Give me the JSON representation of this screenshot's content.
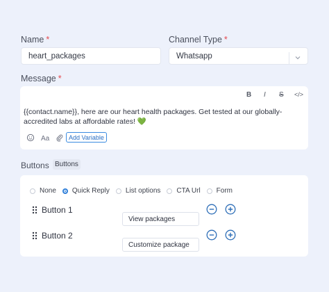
{
  "name": {
    "label": "Name",
    "required_mark": "*",
    "value": "heart_packages"
  },
  "channel": {
    "label": "Channel Type",
    "required_mark": "*",
    "value": "Whatsapp"
  },
  "message": {
    "label": "Message",
    "required_mark": "*",
    "toolbar": {
      "bold": "B",
      "italic": "I",
      "strike": "S",
      "code": "</>"
    },
    "text": "{{contact.name}}, here are our heart health packages. Get tested at our globally-accredited labs at affordable rates! ",
    "emoji": "💚",
    "add_variable_label": "Add Variable"
  },
  "buttons_section": {
    "label": "Buttons",
    "chip": "Buttons",
    "types": [
      {
        "label": "None",
        "selected": false
      },
      {
        "label": "Quick Reply",
        "selected": true
      },
      {
        "label": "List options",
        "selected": false
      },
      {
        "label": "CTA Url",
        "selected": false
      },
      {
        "label": "Form",
        "selected": false
      }
    ],
    "items": [
      {
        "label": "Button 1",
        "value": "View packages"
      },
      {
        "label": "Button 2",
        "value": "Customize package"
      }
    ]
  },
  "colors": {
    "background": "#edf1fb",
    "accent": "#2f7fd9",
    "required": "#e5484d",
    "heart": "#22b34a"
  }
}
